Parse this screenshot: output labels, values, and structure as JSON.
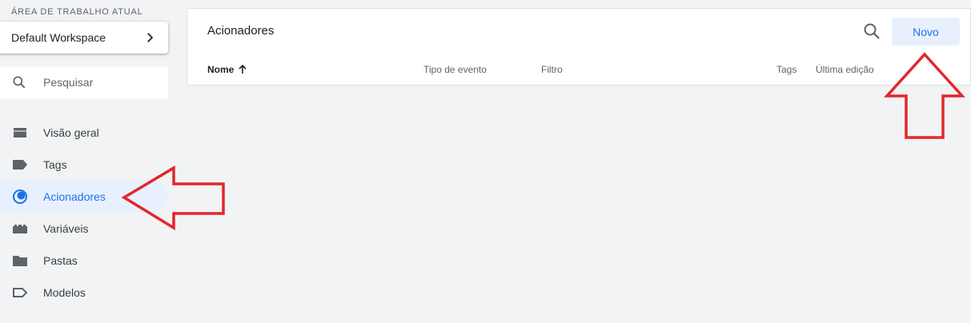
{
  "sidebar": {
    "workspace_label": "ÁREA DE TRABALHO ATUAL",
    "workspace_name": "Default Workspace",
    "search_placeholder": "Pesquisar",
    "items": [
      {
        "label": "Visão geral",
        "icon": "overview-icon"
      },
      {
        "label": "Tags",
        "icon": "tag-icon"
      },
      {
        "label": "Acionadores",
        "icon": "trigger-icon",
        "active": true
      },
      {
        "label": "Variáveis",
        "icon": "variables-icon"
      },
      {
        "label": "Pastas",
        "icon": "folder-icon"
      },
      {
        "label": "Modelos",
        "icon": "template-icon"
      }
    ]
  },
  "main": {
    "title": "Acionadores",
    "new_label": "Novo",
    "columns": [
      "Nome",
      "Tipo de evento",
      "Filtro",
      "Tags",
      "Última edição"
    ]
  },
  "colors": {
    "accent": "#1a73e8",
    "active_bg": "#e8f0fe",
    "annotation": "#e3262d",
    "background": "#f1f3f4"
  }
}
